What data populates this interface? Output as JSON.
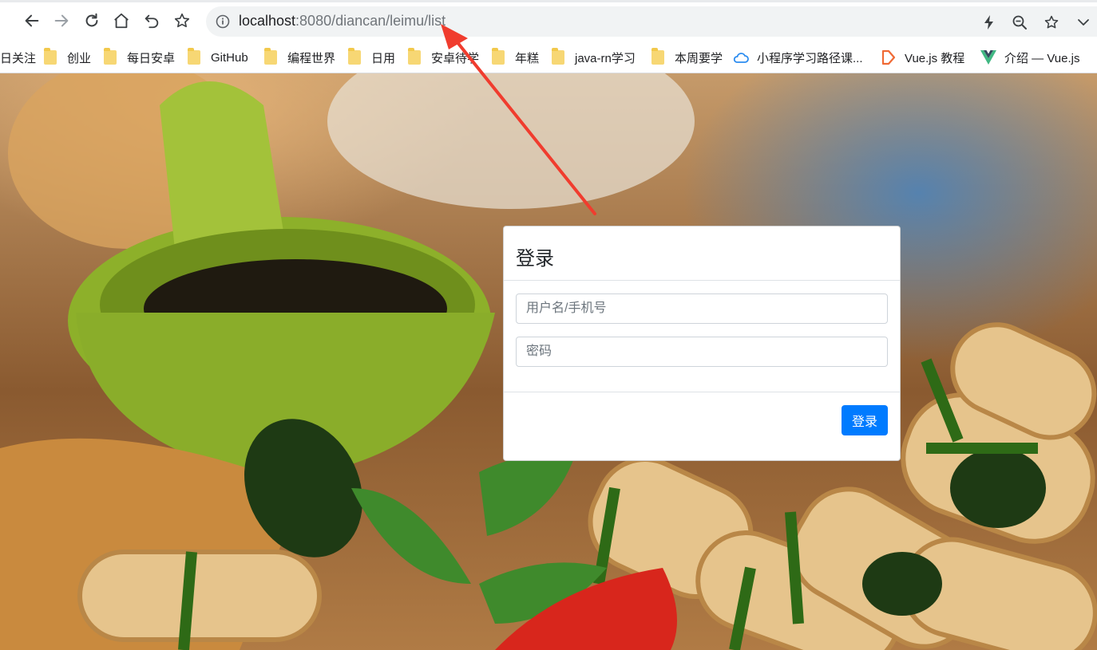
{
  "browser": {
    "url_host": "localhost",
    "url_rest": ":8080/diancan/leimu/list",
    "icons": {
      "back": "arrow-left-icon",
      "forward": "arrow-right-icon",
      "reload": "reload-icon",
      "home": "home-icon",
      "undo": "undo-icon",
      "bookmark_star": "star-icon",
      "info": "info-icon",
      "lightning": "lightning-icon",
      "zoom": "zoom-icon",
      "favorite": "star-icon",
      "menu": "chevron-down-icon"
    }
  },
  "bookmarks": [
    {
      "label": "日关注",
      "icon": "none"
    },
    {
      "label": "创业",
      "icon": "folder-icon"
    },
    {
      "label": "每日安卓",
      "icon": "folder-icon"
    },
    {
      "label": "GitHub",
      "icon": "folder-icon"
    },
    {
      "label": "编程世界",
      "icon": "folder-icon"
    },
    {
      "label": "日用",
      "icon": "folder-icon"
    },
    {
      "label": "安卓待学",
      "icon": "folder-icon"
    },
    {
      "label": "年糕",
      "icon": "folder-icon"
    },
    {
      "label": "java-rn学习",
      "icon": "folder-icon"
    },
    {
      "label": "本周要学",
      "icon": "folder-icon"
    },
    {
      "label": "小程序学习路径课...",
      "icon": "cloud-icon"
    },
    {
      "label": "Vue.js 教程",
      "icon": "runoob-icon"
    },
    {
      "label": "介绍 — Vue.js",
      "icon": "vue-icon"
    }
  ],
  "login": {
    "title": "登录",
    "username_placeholder": "用户名/手机号",
    "password_placeholder": "密码",
    "submit_label": "登录"
  },
  "colors": {
    "primary_button": "#007bff",
    "annotation_arrow": "#f03c2e"
  }
}
